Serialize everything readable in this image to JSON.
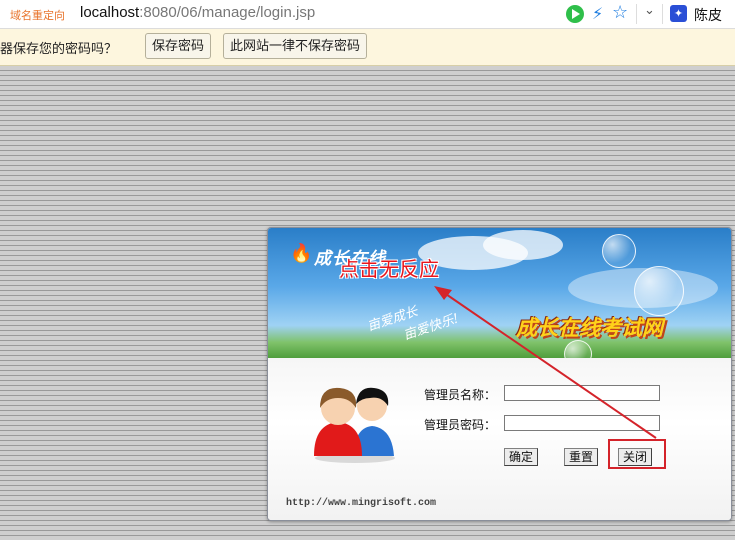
{
  "browser": {
    "redirect_tag": "域名重定向",
    "url_host": "localhost",
    "url_rest": ":8080/06/manage/login.jsp",
    "user_name": "陈皮",
    "icons": [
      "play-icon",
      "bolt-icon",
      "star-icon",
      "chevron-down-icon",
      "paw-icon"
    ]
  },
  "password_bar": {
    "message": "器保存您的密码吗？",
    "save_label": "保存密码",
    "never_label": "此网站一律不保存密码"
  },
  "login": {
    "logo_text": "成长在线",
    "slogan_line1": "亩爱成长",
    "slogan_line2": "亩爱快乐!",
    "site_title": "成长在线考试网",
    "admin_name_label": "管理员名称：",
    "admin_name_value": "",
    "admin_password_label": "管理员密码：",
    "admin_password_value": "",
    "confirm_label": "确定",
    "reset_label": "重置",
    "close_label": "关闭",
    "footer_url": "http://www.mingrisoft.com"
  },
  "annotation": {
    "text": "点击无反应",
    "color": "#e8151b"
  },
  "colors": {
    "accent_red": "#d4232a",
    "banner_blue": "#2a7ec8",
    "title_yellow": "#ffd21a"
  }
}
